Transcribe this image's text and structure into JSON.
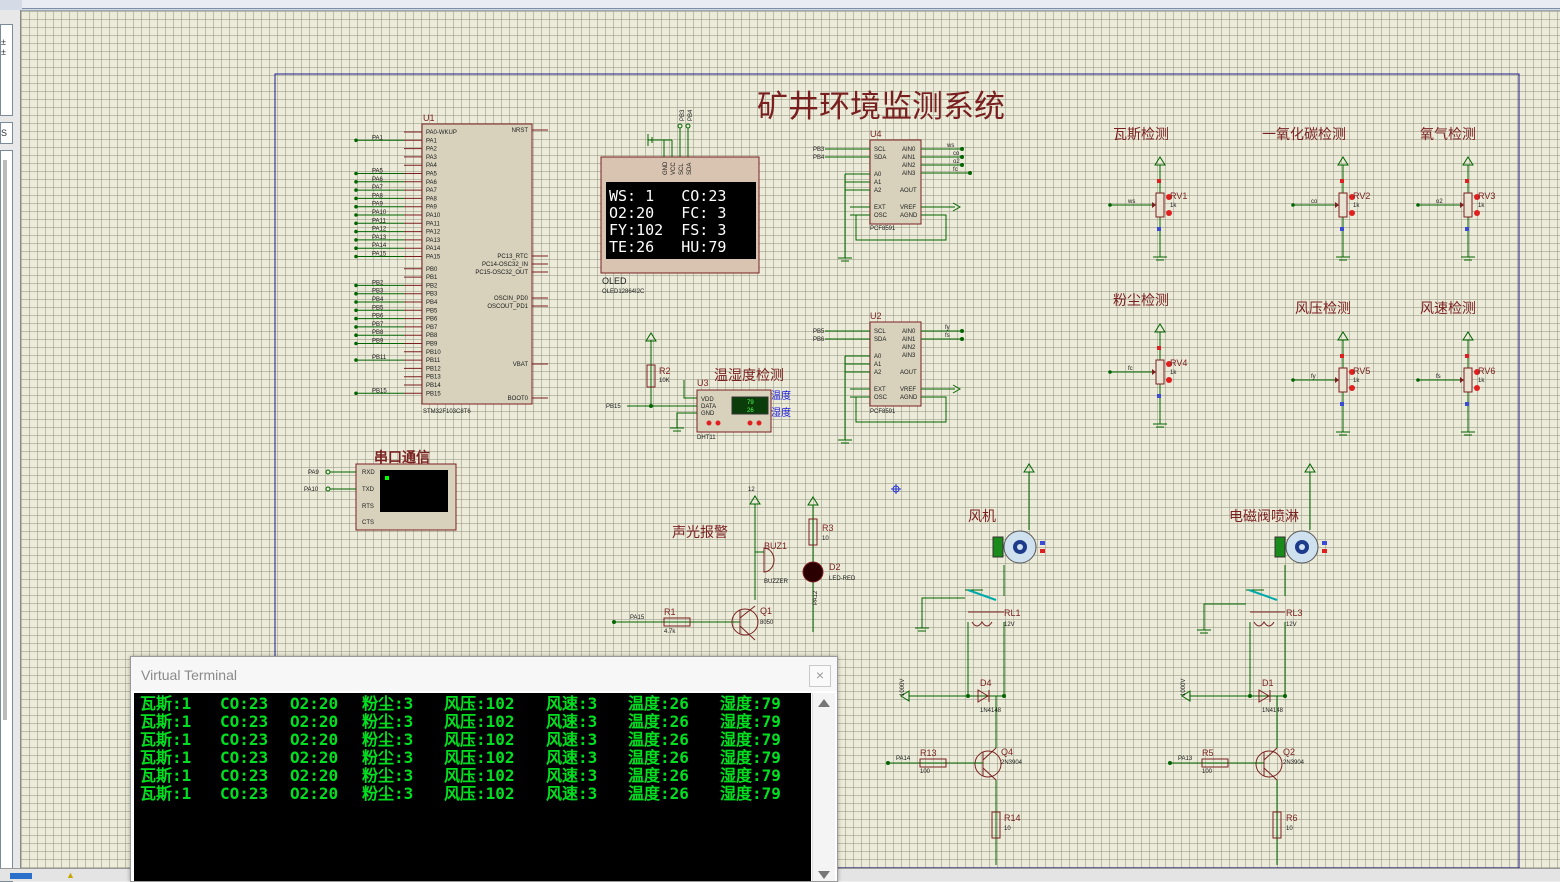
{
  "schematic": {
    "title": "矿井环境监测系统",
    "labels": {
      "uart": "串口通信",
      "dht_section": "温湿度检测",
      "alarm": "声光报警",
      "fan": "风机",
      "valve": "电磁阀喷淋",
      "gas": "瓦斯检测",
      "co": "一氧化碳检测",
      "o2": "氧气检测",
      "dust": "粉尘检测",
      "wind_pressure": "风压检测",
      "wind_speed": "风速检测",
      "temp_label": "温度",
      "hum_label": "湿度"
    },
    "mcu": {
      "ref": "U1",
      "part": "STM32F103C8T6",
      "pins_left": [
        "PA0-WKUP",
        "PA1",
        "PA2",
        "PA3",
        "PA4",
        "PA5",
        "PA6",
        "PA7",
        "PA8",
        "PA9",
        "PA10",
        "PA11",
        "PA12",
        "PA13",
        "PA14",
        "PA15",
        "PB0",
        "PB1",
        "PB2",
        "PB3",
        "PB4",
        "PB5",
        "PB6",
        "PB7",
        "PB8",
        "PB9",
        "PB10",
        "PB11",
        "PB12",
        "PB13",
        "PB14",
        "PB15"
      ],
      "pins_right": [
        "NRST",
        "PC13_RTC",
        "PC14-OSC32_IN",
        "PC15-OSC32_OUT",
        "OSCIN_PD0",
        "OSCOUT_PD1",
        "VBAT",
        "BOOT0"
      ],
      "net_labels": [
        "PA1",
        "PA5",
        "PA6",
        "PA7",
        "PA8",
        "PA9",
        "PA10",
        "PA11",
        "PA12",
        "PA13",
        "PA14",
        "PA15",
        "PB2",
        "PB3",
        "PB4",
        "PB5",
        "PB6",
        "PB7",
        "PB8",
        "PB9",
        "PB11",
        "PB15"
      ]
    },
    "oled": {
      "label": "OLED",
      "part": "OLED12864I2C",
      "pins": [
        "GND",
        "VCC",
        "SCL",
        "SDA"
      ],
      "top_labels": [
        "PB3",
        "PB4"
      ],
      "lines": [
        "WS: 1   CO:23",
        "O2:20   FC: 3",
        "FY:102  FS: 3",
        "TE:26   HU:79"
      ]
    },
    "adc_u4": {
      "ref": "U4",
      "part": "PCF8591",
      "pins_left": [
        "SCL",
        "SDA",
        "A0",
        "A1",
        "A2",
        "EXT",
        "OSC"
      ],
      "pins_right": [
        "AIN0",
        "AIN1",
        "AIN2",
        "AIN3",
        "AOUT",
        "VREF",
        "AGND"
      ],
      "net_in": [
        "PB3",
        "PB4"
      ],
      "net_out": [
        "ws",
        "co",
        "o2",
        "fc"
      ]
    },
    "adc_u2": {
      "ref": "U2",
      "part": "PCF8591",
      "pins_left": [
        "SCL",
        "SDA",
        "A0",
        "A1",
        "A2",
        "EXT",
        "OSC"
      ],
      "pins_right": [
        "AIN0",
        "AIN1",
        "AIN2",
        "AIN3",
        "AOUT",
        "VREF",
        "AGND"
      ],
      "net_in": [
        "PB5",
        "PB6"
      ],
      "net_out": [
        "fy",
        "fs"
      ]
    },
    "pots": [
      {
        "ref": "RV1",
        "value": "1k",
        "net": "ws"
      },
      {
        "ref": "RV2",
        "value": "1k",
        "net": "co"
      },
      {
        "ref": "RV3",
        "value": "1k",
        "net": "o2"
      },
      {
        "ref": "RV4",
        "value": "1k",
        "net": "fc"
      },
      {
        "ref": "RV5",
        "value": "1k",
        "net": "fy"
      },
      {
        "ref": "RV6",
        "value": "1k",
        "net": "fs"
      }
    ],
    "dht": {
      "ref": "U3",
      "part": "DHT11",
      "pins": [
        "VDD",
        "DATA",
        "GND"
      ],
      "temp": "79",
      "hum": "26",
      "r_ref": "R2",
      "r_val": "10K",
      "net": "PB15"
    },
    "uart_term": {
      "pins": [
        "RXD",
        "TXD",
        "RTS",
        "CTS"
      ],
      "nets": [
        "PA9",
        "PA10"
      ]
    },
    "buzzer": {
      "ref": "BUZ1",
      "part": "BUZZER",
      "supply": "12"
    },
    "led": {
      "ref": "D2",
      "part": "LED-RED",
      "r_ref": "R3",
      "r_val": "10",
      "net": "PA12"
    },
    "q1": {
      "ref": "Q1",
      "part": "8050",
      "r_ref": "R1",
      "r_val": "4.7k",
      "net": "PA15"
    },
    "relay1": {
      "ref": "RL1",
      "val": "12V",
      "d_ref": "D4",
      "d_part": "1N4148",
      "q_ref": "Q4",
      "q_part": "2N3904",
      "rb_ref": "R13",
      "rb_val": "100",
      "re_ref": "R14",
      "re_val": "10",
      "net": "PA14",
      "supply": "1000V"
    },
    "relay2": {
      "ref": "RL3",
      "val": "12V",
      "d_ref": "D1",
      "d_part": "1N4148",
      "q_ref": "Q2",
      "q_part": "2N3904",
      "rb_ref": "R5",
      "rb_val": "100",
      "re_ref": "R6",
      "re_val": "10",
      "net": "PA13",
      "supply": "1000V"
    }
  },
  "terminal": {
    "title": "Virtual Terminal",
    "close": "×",
    "rows": [
      [
        "瓦斯:1",
        "CO:23",
        "O2:20",
        "粉尘:3",
        "风压:102",
        "风速:3",
        "温度:26",
        "湿度:79"
      ],
      [
        "瓦斯:1",
        "CO:23",
        "O2:20",
        "粉尘:3",
        "风压:102",
        "风速:3",
        "温度:26",
        "湿度:79"
      ],
      [
        "瓦斯:1",
        "CO:23",
        "O2:20",
        "粉尘:3",
        "风压:102",
        "风速:3",
        "温度:26",
        "湿度:79"
      ],
      [
        "瓦斯:1",
        "CO:23",
        "O2:20",
        "粉尘:3",
        "风压:102",
        "风速:3",
        "温度:26",
        "湿度:79"
      ],
      [
        "瓦斯:1",
        "CO:23",
        "O2:20",
        "粉尘:3",
        "风压:102",
        "风速:3",
        "温度:26",
        "湿度:79"
      ],
      [
        "瓦斯:1",
        "CO:23",
        "O2:20",
        "粉尘:3",
        "风压:102",
        "风速:3",
        "温度:26",
        "湿度:79"
      ]
    ]
  },
  "colors": {
    "wire": "#008000",
    "component": "#7a1f1f",
    "body_fill": "#d8d2bd",
    "label": "#7a1f1f",
    "terminal_text": "#00e020",
    "frame": "#1a1a8c"
  }
}
